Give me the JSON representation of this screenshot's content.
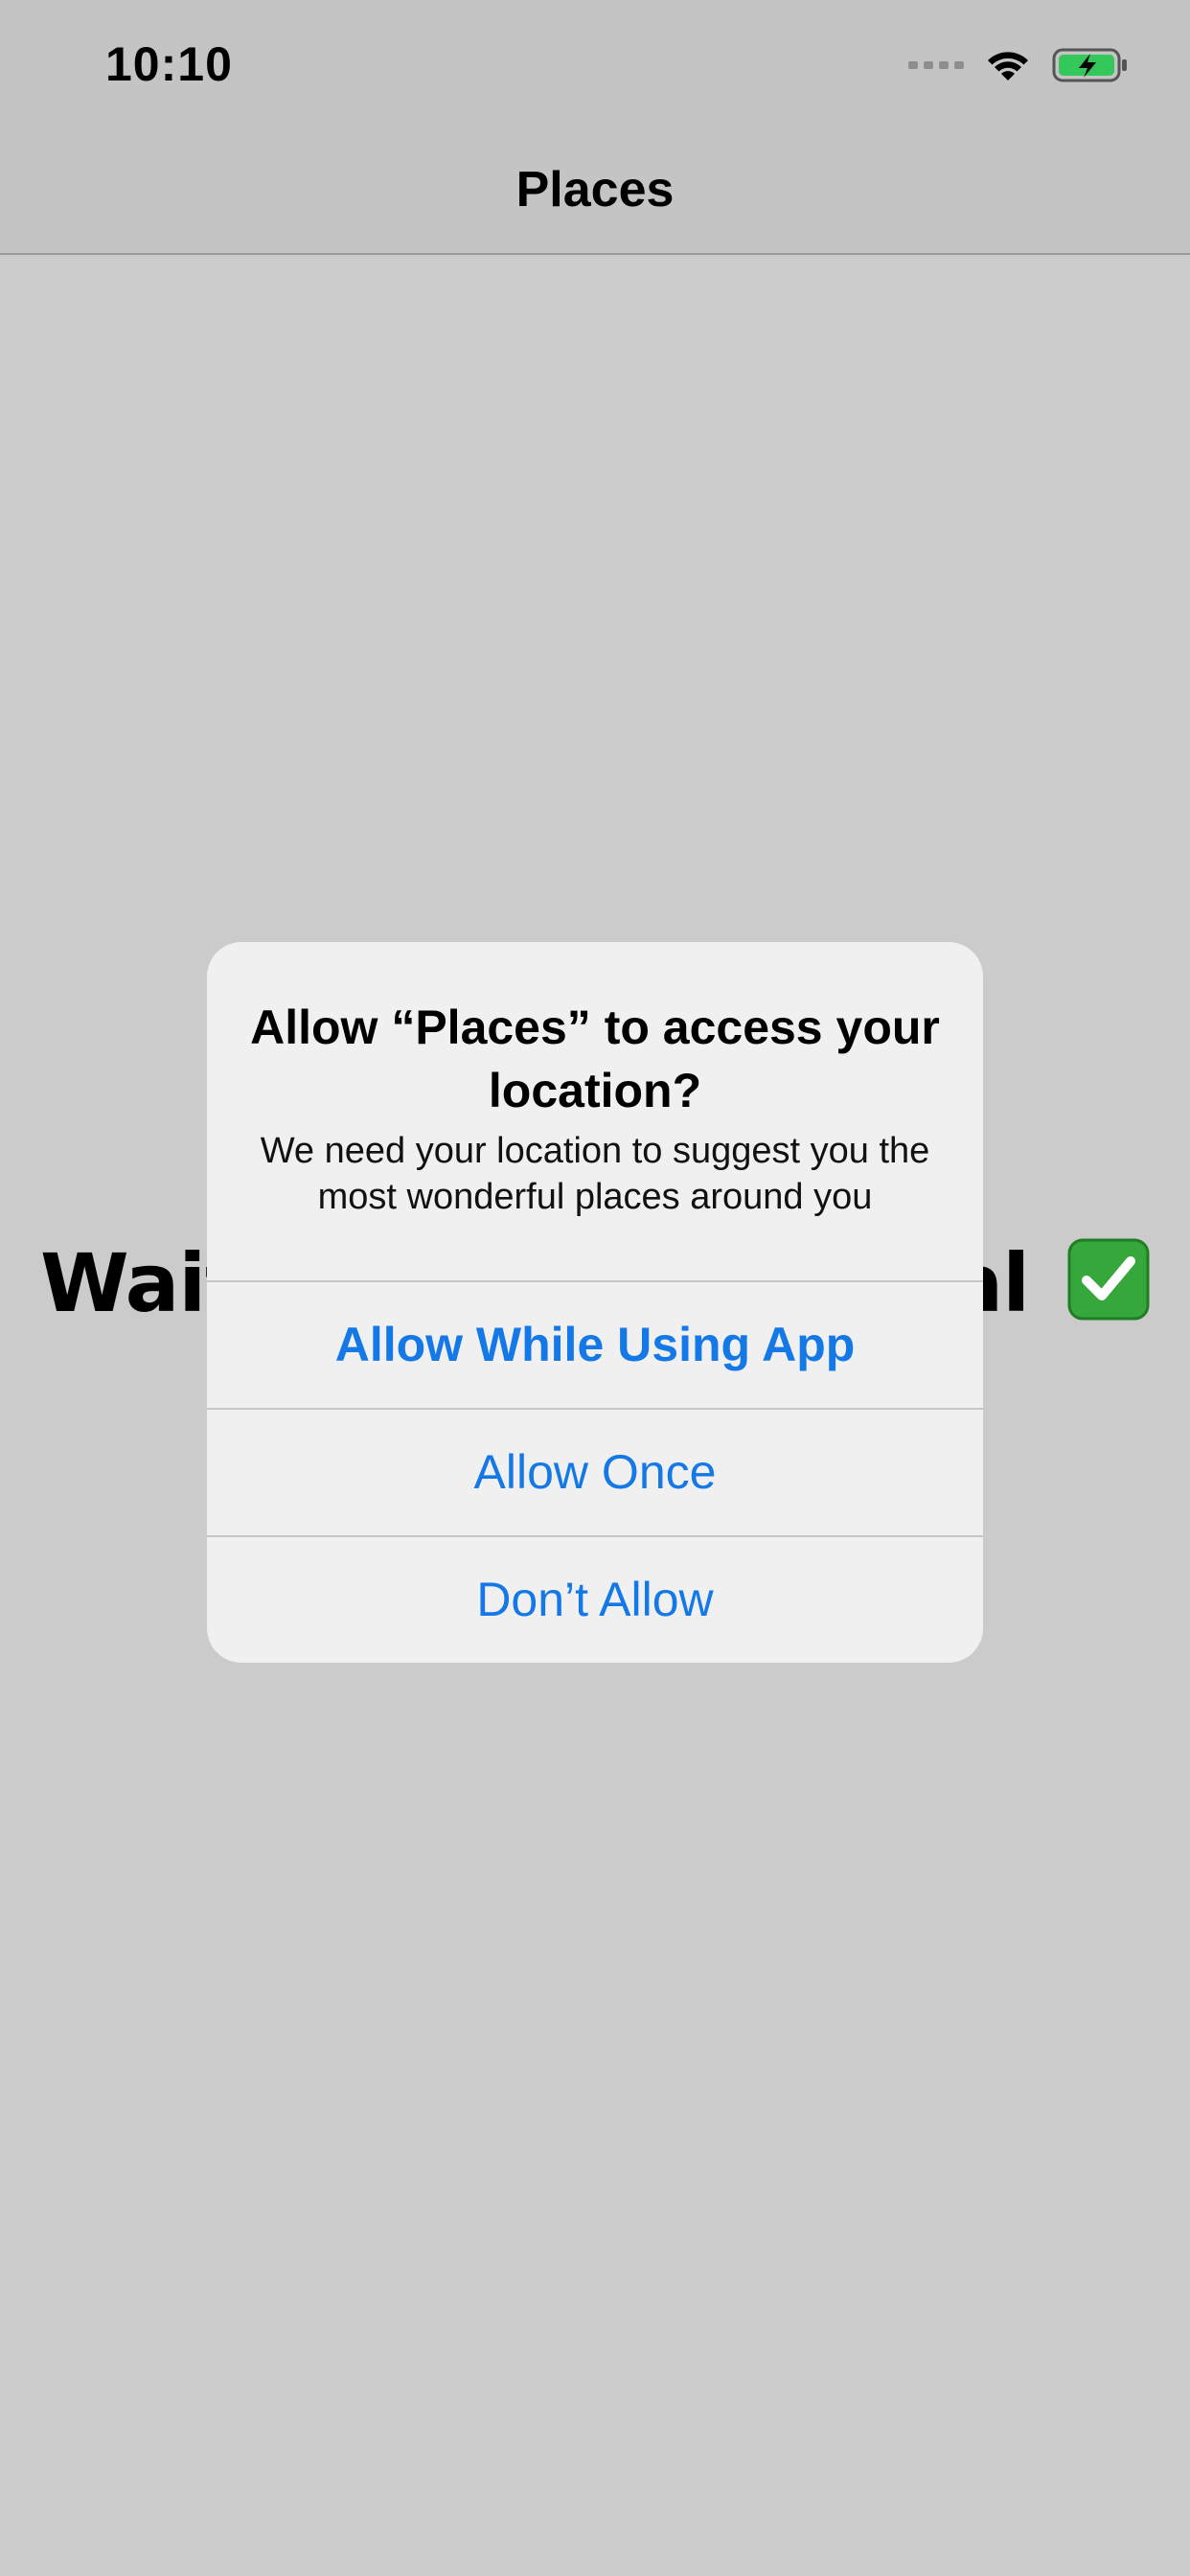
{
  "status_bar": {
    "time": "10:10",
    "icons": [
      "cellular-signal-icon",
      "wifi-icon",
      "battery-charging-icon"
    ]
  },
  "nav": {
    "title": "Places"
  },
  "background": {
    "message_left": "Wait",
    "message_right": "val",
    "check_icon": "check-mark-button-icon"
  },
  "alert": {
    "title": "Allow “Places” to access your location?",
    "message": "We need your location to suggest you the most wonderful places around you",
    "buttons": {
      "allow_while_using": "Allow While Using App",
      "allow_once": "Allow Once",
      "dont_allow": "Don’t Allow"
    }
  },
  "colors": {
    "accent": "#1478e6",
    "backdrop": "#cbcbcb",
    "alert_bg": "#f0f0f0",
    "battery_green": "#34c759",
    "check_green": "#36a83b"
  }
}
